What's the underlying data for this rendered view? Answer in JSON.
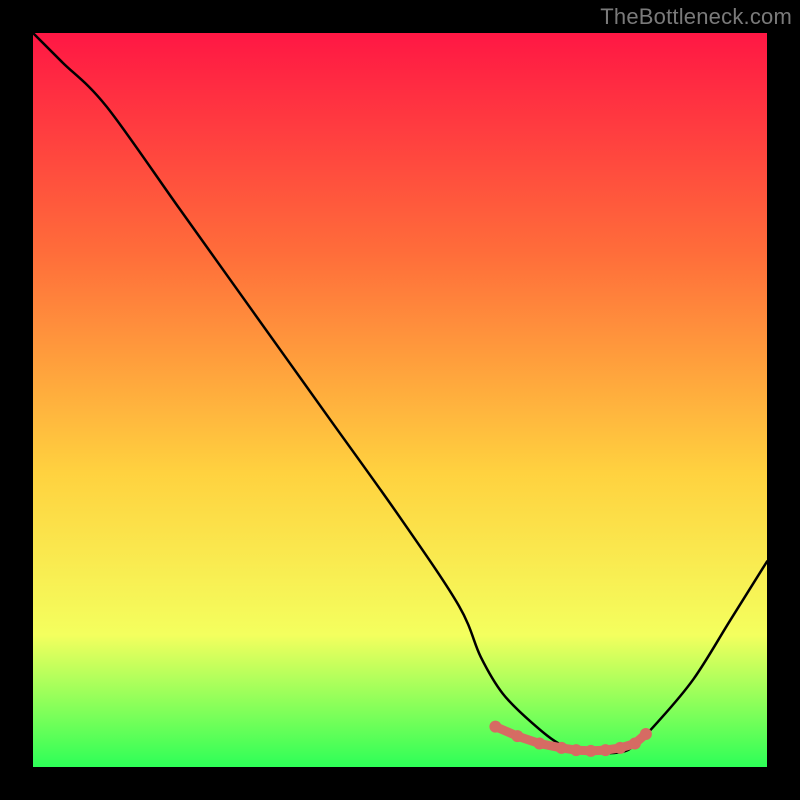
{
  "watermark": "TheBottleneck.com",
  "chart_data": {
    "type": "line",
    "title": "",
    "xlabel": "",
    "ylabel": "",
    "xlim": [
      0,
      100
    ],
    "ylim": [
      0,
      100
    ],
    "series": [
      {
        "name": "curve",
        "x": [
          0,
          4,
          10,
          20,
          30,
          40,
          50,
          58,
          61,
          64,
          68,
          72,
          76,
          80,
          82,
          85,
          90,
          95,
          100
        ],
        "y": [
          100,
          96,
          90,
          76,
          62,
          48,
          34,
          22,
          15,
          10,
          6,
          3,
          2,
          2,
          3,
          6,
          12,
          20,
          28
        ]
      }
    ],
    "flat_segment": {
      "x": [
        63,
        66,
        69,
        72,
        74,
        76,
        78,
        80,
        82,
        83.5
      ],
      "y": [
        5.5,
        4.2,
        3.2,
        2.6,
        2.3,
        2.2,
        2.3,
        2.6,
        3.2,
        4.5
      ]
    },
    "colors": {
      "gradient_top": "#ff1744",
      "gradient_mid1": "#ff6d3a",
      "gradient_mid2": "#ffd23f",
      "gradient_mid3": "#f4ff5e",
      "gradient_bottom": "#2dff57",
      "curve": "#000000",
      "dots": "#d66b63",
      "frame": "#000000"
    }
  }
}
